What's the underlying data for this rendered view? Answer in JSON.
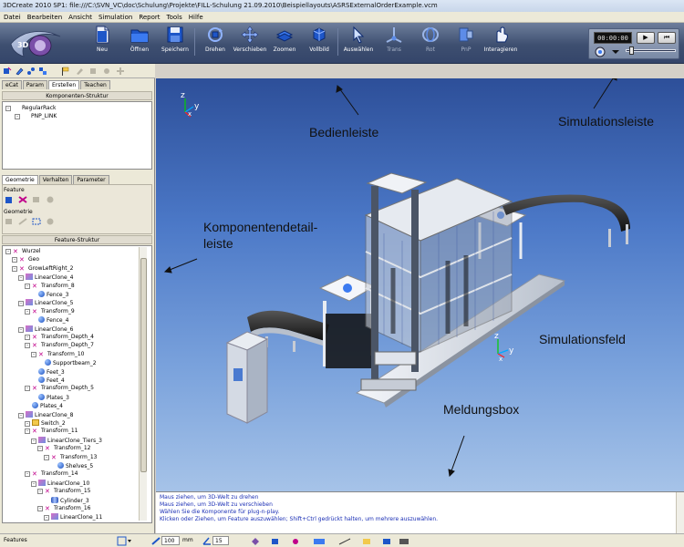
{
  "window": {
    "title": "3DCreate 2010 SP1: file:///C:\\SVN_VC\\doc\\Schulung\\Projekte\\FILL-Schulung 21.09.2010\\Beispiellayouts\\ASRSExternalOrderExample.vcm"
  },
  "menu": [
    "Datei",
    "Bearbeiten",
    "Ansicht",
    "Simulation",
    "Report",
    "Tools",
    "Hilfe"
  ],
  "toolbar": {
    "buttons": [
      {
        "label": "Neu",
        "icon": "new-file-icon"
      },
      {
        "label": "Öffnen",
        "icon": "folder-icon"
      },
      {
        "label": "Speichern",
        "icon": "save-icon"
      },
      {
        "label": "Drehen",
        "icon": "rotate-icon"
      },
      {
        "label": "Verschieben",
        "icon": "pan-icon"
      },
      {
        "label": "Zoomen",
        "icon": "zoom-icon"
      },
      {
        "label": "Vollbild",
        "icon": "fit-view-icon"
      },
      {
        "label": "Auswählen",
        "icon": "select-arrow-icon"
      },
      {
        "label": "Trans",
        "icon": "translate-icon",
        "disabled": true
      },
      {
        "label": "Rot",
        "icon": "rotate-gizmo-icon",
        "disabled": true
      },
      {
        "label": "PnP",
        "icon": "plug-and-play-icon",
        "disabled": true
      },
      {
        "label": "Interagieren",
        "icon": "interact-icon"
      }
    ]
  },
  "simulation": {
    "time": "00:00:00",
    "play_label": "▶",
    "reset_label": "⏮"
  },
  "left_panel": {
    "tabs": [
      "eCat",
      "Param",
      "Erstellen",
      "Teachen"
    ],
    "active_tab": "Erstellen",
    "component_structure_header": "Komponenten-Struktur",
    "component_tree": [
      {
        "label": "RegularRack",
        "depth": 0,
        "icon": "rack-icon"
      },
      {
        "label": "PNP_LINK",
        "depth": 1,
        "icon": "link-icon"
      }
    ],
    "detail_tabs": [
      "Geometrie",
      "Verhalten",
      "Parameter"
    ],
    "active_detail_tab": "Geometrie",
    "feature_label": "Feature",
    "geometry_label": "Geometrie",
    "feature_structure_header": "Feature-Struktur",
    "feature_tree": [
      {
        "label": "Wurzel",
        "depth": 0,
        "icon": "x"
      },
      {
        "label": "Geo",
        "depth": 1,
        "icon": "x"
      },
      {
        "label": "GrowLeftRight_2",
        "depth": 1,
        "icon": "x"
      },
      {
        "label": "LinearClone_4",
        "depth": 2,
        "icon": "lin"
      },
      {
        "label": "Transform_8",
        "depth": 3,
        "icon": "x"
      },
      {
        "label": "Fence_3",
        "depth": 4,
        "icon": "sphere"
      },
      {
        "label": "LinearClone_5",
        "depth": 2,
        "icon": "lin"
      },
      {
        "label": "Transform_9",
        "depth": 3,
        "icon": "x"
      },
      {
        "label": "Fence_4",
        "depth": 4,
        "icon": "sphere"
      },
      {
        "label": "LinearClone_6",
        "depth": 2,
        "icon": "lin"
      },
      {
        "label": "Transform_Depth_4",
        "depth": 3,
        "icon": "x"
      },
      {
        "label": "Transform_Depth_7",
        "depth": 3,
        "icon": "x"
      },
      {
        "label": "Transform_10",
        "depth": 4,
        "icon": "x"
      },
      {
        "label": "Supportbeam_2",
        "depth": 5,
        "icon": "sphere"
      },
      {
        "label": "Feet_3",
        "depth": 4,
        "icon": "sphere"
      },
      {
        "label": "Feet_4",
        "depth": 4,
        "icon": "sphere"
      },
      {
        "label": "Transform_Depth_5",
        "depth": 3,
        "icon": "x"
      },
      {
        "label": "Plates_3",
        "depth": 4,
        "icon": "sphere"
      },
      {
        "label": "Plates_4",
        "depth": 3,
        "icon": "sphere"
      },
      {
        "label": "LinearClone_8",
        "depth": 2,
        "icon": "lin"
      },
      {
        "label": "Switch_2",
        "depth": 3,
        "icon": "folder"
      },
      {
        "label": "Transform_11",
        "depth": 3,
        "icon": "x"
      },
      {
        "label": "LinearClone_Tiers_3",
        "depth": 4,
        "icon": "lin"
      },
      {
        "label": "Transform_12",
        "depth": 5,
        "icon": "x"
      },
      {
        "label": "Transform_13",
        "depth": 6,
        "icon": "x"
      },
      {
        "label": "Shelves_5",
        "depth": 7,
        "icon": "sphere"
      },
      {
        "label": "Transform_14",
        "depth": 3,
        "icon": "x"
      },
      {
        "label": "LinearClone_10",
        "depth": 4,
        "icon": "lin"
      },
      {
        "label": "Transform_15",
        "depth": 5,
        "icon": "x"
      },
      {
        "label": "Cylinder_3",
        "depth": 6,
        "icon": "cyl"
      },
      {
        "label": "Transform_16",
        "depth": 5,
        "icon": "x"
      },
      {
        "label": "LinearClone_11",
        "depth": 6,
        "icon": "lin"
      }
    ]
  },
  "viewport": {
    "axis_labels": {
      "z": "z",
      "y": "y",
      "x": "x"
    },
    "annotations": {
      "bedienleiste": "Bedienleiste",
      "simulationsleiste": "Simulationsleiste",
      "komponentendetail_1": "Komponentendetail-",
      "komponentendetail_2": "leiste",
      "simulationsfeld": "Simulationsfeld",
      "meldungsbox": "Meldungsbox"
    }
  },
  "messages": [
    "Maus ziehen, um 3D-Welt zu drehen",
    "Maus ziehen, um 3D-Welt zu verschieben",
    "Wählen Sie die Komponente für plug-n-play.",
    "Klicken oder Ziehen, um Feature auszuwählen; Shift+Ctrl gedrückt halten, um mehrere auszuwählen."
  ],
  "statusbar": {
    "mode": "Features",
    "distance_value": "100",
    "distance_unit": "mm",
    "angle_value": "15"
  },
  "colors": {
    "toolbar_bg": "#3e4f70",
    "viewport_top": "#2d4f99",
    "viewport_bottom": "#a6c3e8",
    "message_text": "#1b2fb5",
    "x_icon": "#c0008a"
  }
}
